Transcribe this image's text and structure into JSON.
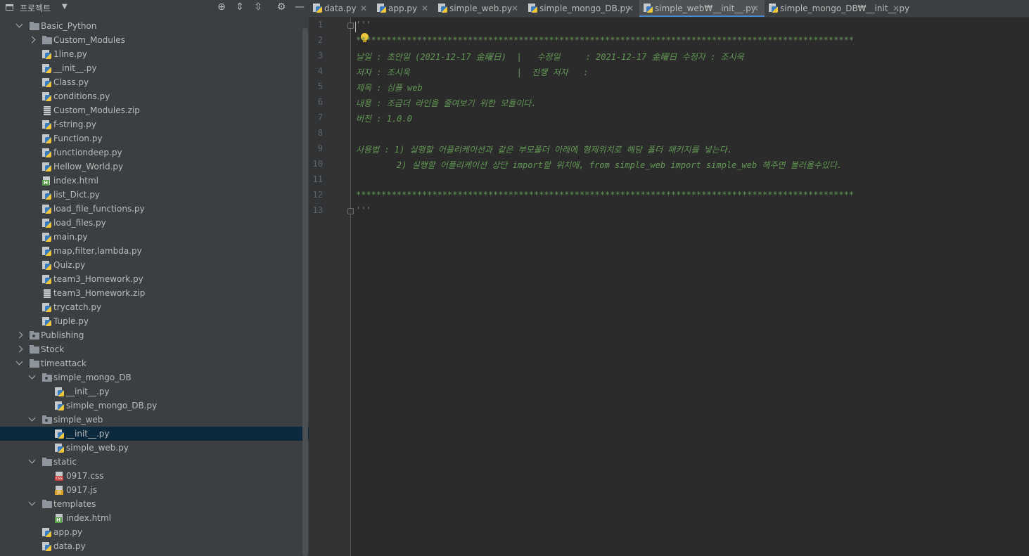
{
  "project_panel": {
    "title": "프로젝트",
    "header_icons": [
      "locate-icon",
      "expand-all-icon",
      "collapse-all-icon",
      "settings-icon",
      "hide-icon"
    ]
  },
  "tree": [
    {
      "label": "Basic_Python",
      "type": "folder",
      "depth": 1,
      "expanded": true
    },
    {
      "label": "Custom_Modules",
      "type": "folder",
      "depth": 2,
      "expanded": false
    },
    {
      "label": "1line.py",
      "type": "py",
      "depth": 3
    },
    {
      "label": "__init__.py",
      "type": "py",
      "depth": 3
    },
    {
      "label": "Class.py",
      "type": "py",
      "depth": 3
    },
    {
      "label": "conditions.py",
      "type": "py",
      "depth": 3
    },
    {
      "label": "Custom_Modules.zip",
      "type": "zip",
      "depth": 3
    },
    {
      "label": "f-string.py",
      "type": "py",
      "depth": 3
    },
    {
      "label": "Function.py",
      "type": "py",
      "depth": 3
    },
    {
      "label": "functiondeep.py",
      "type": "py",
      "depth": 3
    },
    {
      "label": "Hellow_World.py",
      "type": "py",
      "depth": 3
    },
    {
      "label": "index.html",
      "type": "html",
      "depth": 3
    },
    {
      "label": "list_Dict.py",
      "type": "py",
      "depth": 3
    },
    {
      "label": "load_file_functions.py",
      "type": "py",
      "depth": 3
    },
    {
      "label": "load_files.py",
      "type": "py",
      "depth": 3
    },
    {
      "label": "main.py",
      "type": "py",
      "depth": 3
    },
    {
      "label": "map,filter,lambda.py",
      "type": "py",
      "depth": 3
    },
    {
      "label": "Quiz.py",
      "type": "py",
      "depth": 3
    },
    {
      "label": "team3_Homework.py",
      "type": "py",
      "depth": 3
    },
    {
      "label": "team3_Homework.zip",
      "type": "zip",
      "depth": 3
    },
    {
      "label": "trycatch.py",
      "type": "py",
      "depth": 3
    },
    {
      "label": "Tuple.py",
      "type": "py",
      "depth": 3
    },
    {
      "label": "Publishing",
      "type": "folder-pkg",
      "depth": 1,
      "expanded": false
    },
    {
      "label": "Stock",
      "type": "folder",
      "depth": 1,
      "expanded": false
    },
    {
      "label": "timeattack",
      "type": "folder",
      "depth": 1,
      "expanded": true
    },
    {
      "label": "simple_mongo_DB",
      "type": "folder-pkg",
      "depth": 2,
      "expanded": true
    },
    {
      "label": "__init__.py",
      "type": "py",
      "depth": 4
    },
    {
      "label": "simple_mongo_DB.py",
      "type": "py",
      "depth": 4
    },
    {
      "label": "simple_web",
      "type": "folder-pkg",
      "depth": 2,
      "expanded": true
    },
    {
      "label": "__init__.py",
      "type": "py",
      "depth": 4,
      "selected": true
    },
    {
      "label": "simple_web.py",
      "type": "py",
      "depth": 4
    },
    {
      "label": "static",
      "type": "folder",
      "depth": 2,
      "expanded": true
    },
    {
      "label": "0917.css",
      "type": "css",
      "depth": 4
    },
    {
      "label": "0917.js",
      "type": "js",
      "depth": 4
    },
    {
      "label": "templates",
      "type": "folder",
      "depth": 2,
      "expanded": true
    },
    {
      "label": "index.html",
      "type": "html",
      "depth": 4
    },
    {
      "label": "app.py",
      "type": "py",
      "depth": 3
    },
    {
      "label": "data.py",
      "type": "py",
      "depth": 3
    }
  ],
  "tabs": [
    {
      "label": "data.py",
      "active": false
    },
    {
      "label": "app.py",
      "active": false
    },
    {
      "label": "simple_web.py",
      "active": false
    },
    {
      "label": "simple_mongo_DB.py",
      "active": false
    },
    {
      "label": "simple_web₩__init__.py",
      "active": true
    },
    {
      "label": "simple_mongo_DB₩__init__.py",
      "active": false
    }
  ],
  "editor": {
    "lines": [
      {
        "n": "1",
        "text": "'''"
      },
      {
        "n": "2",
        "text": "**************************************************************************************************"
      },
      {
        "n": "3",
        "text": "날일 : 초안일 (2021-12-17 金曜日)  |   수정일     : 2021-12-17 金曜日 수정자 : 조시욱"
      },
      {
        "n": "4",
        "text": "저자 : 조시욱                     |  진행 저자   :"
      },
      {
        "n": "5",
        "text": "제목 : 심플 web"
      },
      {
        "n": "6",
        "text": "내용 : 조금더 라인을 줄여보기 위한 모듈이다."
      },
      {
        "n": "7",
        "text": "버전 : 1.0.0"
      },
      {
        "n": "8",
        "text": ""
      },
      {
        "n": "9",
        "text": "사용법 : 1) 실행할 어플리케이션과 같은 부모폴더 아래에 형제위치로 해당 폴더 패키지를 넣는다."
      },
      {
        "n": "10",
        "text": "        2) 실행할 어플리케이션 상단 import할 위치에, from simple_web import simple_web 해주면 불러올수있다."
      },
      {
        "n": "11",
        "text": ""
      },
      {
        "n": "12",
        "text": "**************************************************************************************************"
      },
      {
        "n": "13",
        "text": "'''"
      }
    ]
  },
  "colors": {
    "docstring": "#629755",
    "background": "#2b2b2b",
    "selection": "#0d293e",
    "active_tab_underline": "#4a88c7"
  }
}
